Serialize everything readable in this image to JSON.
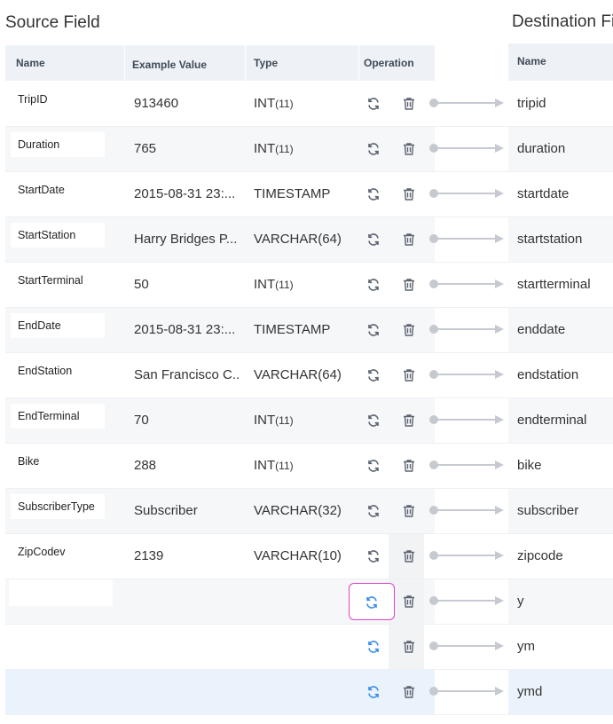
{
  "source": {
    "title": "Source Field",
    "headers": {
      "name": "Name",
      "example": "Example Value",
      "type": "Type",
      "operation": "Operation"
    }
  },
  "destination": {
    "title": "Destination Fi",
    "headers": {
      "name": "Name"
    }
  },
  "rows": [
    {
      "name": "TripID",
      "example": "913460",
      "type": "INT",
      "type_len": "(11)",
      "dest": "tripid"
    },
    {
      "name": "Duration",
      "example": "765",
      "type": "INT",
      "type_len": "(11)",
      "dest": "duration"
    },
    {
      "name": "StartDate",
      "example": "2015-08-31 23:...",
      "type": "TIMESTAMP",
      "type_len": "",
      "dest": "startdate"
    },
    {
      "name": "StartStation",
      "example": "Harry Bridges P...",
      "type": "VARCHAR(64)",
      "type_len": "",
      "dest": "startstation"
    },
    {
      "name": "StartTerminal",
      "example": "50",
      "type": "INT",
      "type_len": "(11)",
      "dest": "startterminal"
    },
    {
      "name": "EndDate",
      "example": "2015-08-31 23:...",
      "type": "TIMESTAMP",
      "type_len": "",
      "dest": "enddate"
    },
    {
      "name": "EndStation",
      "example": "San Francisco C...",
      "type": "VARCHAR(64)",
      "type_len": "",
      "dest": "endstation"
    },
    {
      "name": "EndTerminal",
      "example": "70",
      "type": "INT",
      "type_len": "(11)",
      "dest": "endterminal"
    },
    {
      "name": "Bike",
      "example": "288",
      "type": "INT",
      "type_len": "(11)",
      "dest": "bike"
    },
    {
      "name": "SubscriberType",
      "example": "Subscriber",
      "type": "VARCHAR(32)",
      "type_len": "",
      "dest": "subscriber"
    },
    {
      "name": "ZipCodev",
      "example": "2139",
      "type": "VARCHAR(10)",
      "type_len": "",
      "dest": "zipcode"
    },
    {
      "name": "",
      "example": "",
      "type": "",
      "type_len": "",
      "dest": "y"
    },
    {
      "name": "",
      "example": "",
      "type": "",
      "type_len": "",
      "dest": "ym"
    },
    {
      "name": "",
      "example": "",
      "type": "",
      "type_len": "",
      "dest": "ymd"
    }
  ],
  "icons": {
    "map": "refresh-icon",
    "delete": "trash-icon",
    "arrow": "arrow-right-icon"
  },
  "colors": {
    "header_bg": "#eef2f7",
    "alt_row": "#f6f7f9",
    "selected_row": "#eaf3fb",
    "focus_border": "#e040c8",
    "active_icon": "#3a8ee6"
  }
}
